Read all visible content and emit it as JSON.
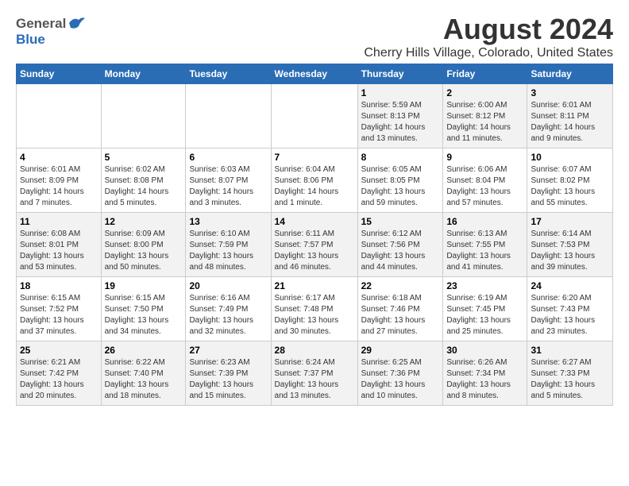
{
  "header": {
    "logo_general": "General",
    "logo_blue": "Blue",
    "title": "August 2024",
    "subtitle": "Cherry Hills Village, Colorado, United States"
  },
  "calendar": {
    "days_of_week": [
      "Sunday",
      "Monday",
      "Tuesday",
      "Wednesday",
      "Thursday",
      "Friday",
      "Saturday"
    ],
    "weeks": [
      [
        {
          "day": "",
          "info": ""
        },
        {
          "day": "",
          "info": ""
        },
        {
          "day": "",
          "info": ""
        },
        {
          "day": "",
          "info": ""
        },
        {
          "day": "1",
          "info": "Sunrise: 5:59 AM\nSunset: 8:13 PM\nDaylight: 14 hours and 13 minutes."
        },
        {
          "day": "2",
          "info": "Sunrise: 6:00 AM\nSunset: 8:12 PM\nDaylight: 14 hours and 11 minutes."
        },
        {
          "day": "3",
          "info": "Sunrise: 6:01 AM\nSunset: 8:11 PM\nDaylight: 14 hours and 9 minutes."
        }
      ],
      [
        {
          "day": "4",
          "info": "Sunrise: 6:01 AM\nSunset: 8:09 PM\nDaylight: 14 hours and 7 minutes."
        },
        {
          "day": "5",
          "info": "Sunrise: 6:02 AM\nSunset: 8:08 PM\nDaylight: 14 hours and 5 minutes."
        },
        {
          "day": "6",
          "info": "Sunrise: 6:03 AM\nSunset: 8:07 PM\nDaylight: 14 hours and 3 minutes."
        },
        {
          "day": "7",
          "info": "Sunrise: 6:04 AM\nSunset: 8:06 PM\nDaylight: 14 hours and 1 minute."
        },
        {
          "day": "8",
          "info": "Sunrise: 6:05 AM\nSunset: 8:05 PM\nDaylight: 13 hours and 59 minutes."
        },
        {
          "day": "9",
          "info": "Sunrise: 6:06 AM\nSunset: 8:04 PM\nDaylight: 13 hours and 57 minutes."
        },
        {
          "day": "10",
          "info": "Sunrise: 6:07 AM\nSunset: 8:02 PM\nDaylight: 13 hours and 55 minutes."
        }
      ],
      [
        {
          "day": "11",
          "info": "Sunrise: 6:08 AM\nSunset: 8:01 PM\nDaylight: 13 hours and 53 minutes."
        },
        {
          "day": "12",
          "info": "Sunrise: 6:09 AM\nSunset: 8:00 PM\nDaylight: 13 hours and 50 minutes."
        },
        {
          "day": "13",
          "info": "Sunrise: 6:10 AM\nSunset: 7:59 PM\nDaylight: 13 hours and 48 minutes."
        },
        {
          "day": "14",
          "info": "Sunrise: 6:11 AM\nSunset: 7:57 PM\nDaylight: 13 hours and 46 minutes."
        },
        {
          "day": "15",
          "info": "Sunrise: 6:12 AM\nSunset: 7:56 PM\nDaylight: 13 hours and 44 minutes."
        },
        {
          "day": "16",
          "info": "Sunrise: 6:13 AM\nSunset: 7:55 PM\nDaylight: 13 hours and 41 minutes."
        },
        {
          "day": "17",
          "info": "Sunrise: 6:14 AM\nSunset: 7:53 PM\nDaylight: 13 hours and 39 minutes."
        }
      ],
      [
        {
          "day": "18",
          "info": "Sunrise: 6:15 AM\nSunset: 7:52 PM\nDaylight: 13 hours and 37 minutes."
        },
        {
          "day": "19",
          "info": "Sunrise: 6:15 AM\nSunset: 7:50 PM\nDaylight: 13 hours and 34 minutes."
        },
        {
          "day": "20",
          "info": "Sunrise: 6:16 AM\nSunset: 7:49 PM\nDaylight: 13 hours and 32 minutes."
        },
        {
          "day": "21",
          "info": "Sunrise: 6:17 AM\nSunset: 7:48 PM\nDaylight: 13 hours and 30 minutes."
        },
        {
          "day": "22",
          "info": "Sunrise: 6:18 AM\nSunset: 7:46 PM\nDaylight: 13 hours and 27 minutes."
        },
        {
          "day": "23",
          "info": "Sunrise: 6:19 AM\nSunset: 7:45 PM\nDaylight: 13 hours and 25 minutes."
        },
        {
          "day": "24",
          "info": "Sunrise: 6:20 AM\nSunset: 7:43 PM\nDaylight: 13 hours and 23 minutes."
        }
      ],
      [
        {
          "day": "25",
          "info": "Sunrise: 6:21 AM\nSunset: 7:42 PM\nDaylight: 13 hours and 20 minutes."
        },
        {
          "day": "26",
          "info": "Sunrise: 6:22 AM\nSunset: 7:40 PM\nDaylight: 13 hours and 18 minutes."
        },
        {
          "day": "27",
          "info": "Sunrise: 6:23 AM\nSunset: 7:39 PM\nDaylight: 13 hours and 15 minutes."
        },
        {
          "day": "28",
          "info": "Sunrise: 6:24 AM\nSunset: 7:37 PM\nDaylight: 13 hours and 13 minutes."
        },
        {
          "day": "29",
          "info": "Sunrise: 6:25 AM\nSunset: 7:36 PM\nDaylight: 13 hours and 10 minutes."
        },
        {
          "day": "30",
          "info": "Sunrise: 6:26 AM\nSunset: 7:34 PM\nDaylight: 13 hours and 8 minutes."
        },
        {
          "day": "31",
          "info": "Sunrise: 6:27 AM\nSunset: 7:33 PM\nDaylight: 13 hours and 5 minutes."
        }
      ]
    ]
  }
}
